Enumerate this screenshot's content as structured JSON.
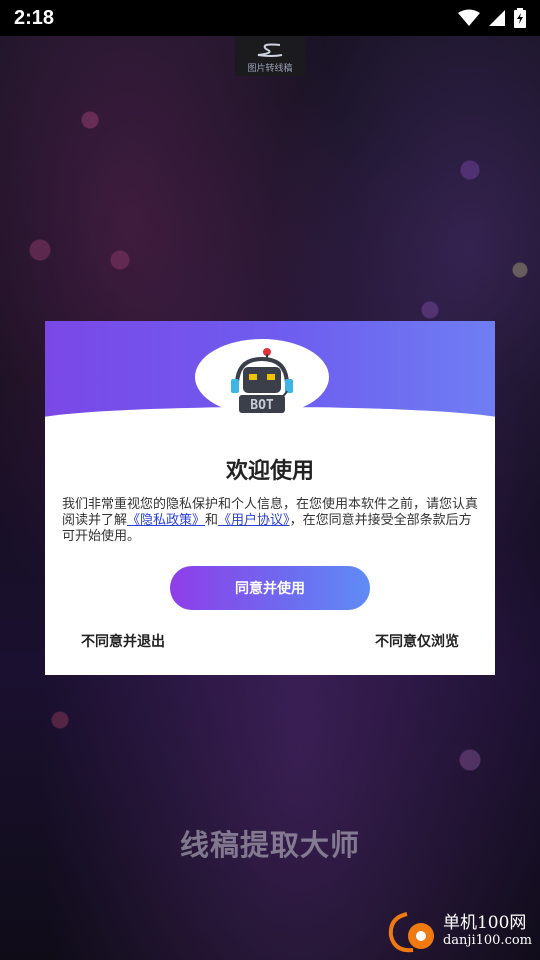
{
  "status_bar": {
    "time": "2:18",
    "icons": [
      "wifi-icon",
      "signal-icon",
      "battery-charging-icon"
    ]
  },
  "top_logo": {
    "label": "图片转线稿"
  },
  "dialog": {
    "robot_label": "BOT",
    "title": "欢迎使用",
    "body_part1": "我们非常重视您的隐私保护和个人信息，在您使用本软件之前，请您认真阅读并了解",
    "privacy_link": "《隐私政策》",
    "body_and": "和",
    "terms_link": "《用户协议》",
    "body_part2": "，在您同意并接受全部条款后方可开始使用。",
    "agree_label": "同意并使用",
    "disagree_exit_label": "不同意并退出",
    "disagree_browse_label": "不同意仅浏览"
  },
  "background": {
    "app_name": "线稿提取大师"
  },
  "watermark": {
    "title": "单机100网",
    "url": "danji100.com"
  },
  "colors": {
    "accent_start": "#8e3ee8",
    "accent_end": "#5f8cf5",
    "link": "#2b3fd6"
  }
}
